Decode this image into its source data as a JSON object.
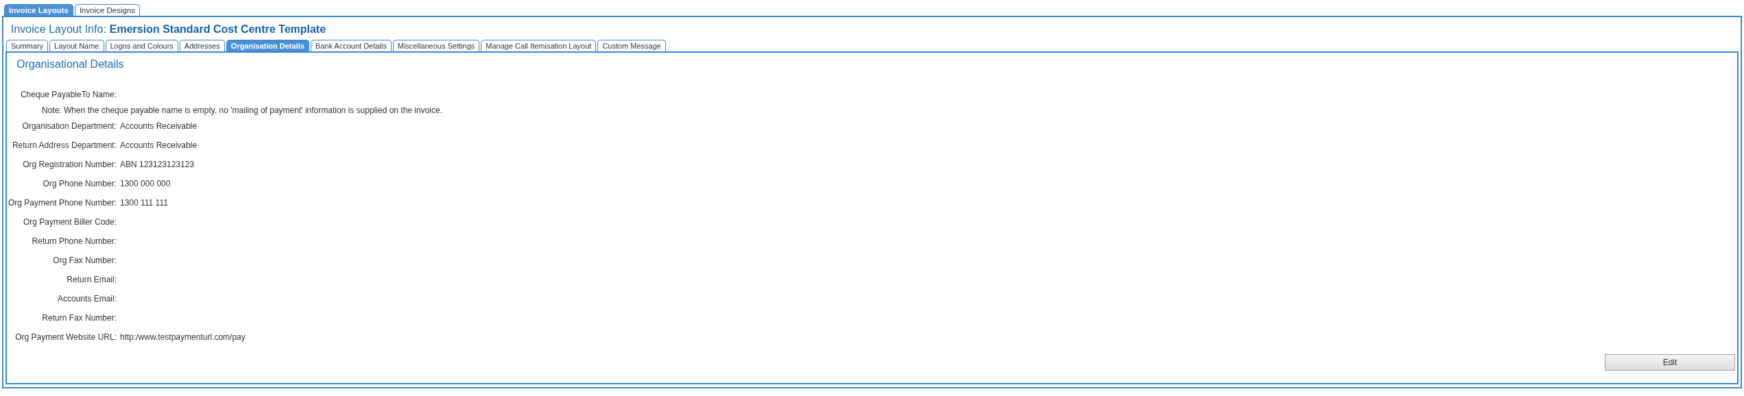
{
  "outer_tabs": [
    {
      "label": "Invoice Layouts",
      "selected": true
    },
    {
      "label": "Invoice Designs",
      "selected": false
    }
  ],
  "header": {
    "label": "Invoice Layout Info:",
    "name": "Emersion Standard Cost Centre Template"
  },
  "inner_tabs": [
    {
      "label": "Summary",
      "selected": false
    },
    {
      "label": "Layout Name",
      "selected": false
    },
    {
      "label": "Logos and Colours",
      "selected": false
    },
    {
      "label": "Addresses",
      "selected": false
    },
    {
      "label": "Organisation Details",
      "selected": true
    },
    {
      "label": "Bank Account Details",
      "selected": false
    },
    {
      "label": "Miscellaneous Settings",
      "selected": false
    },
    {
      "label": "Manage Call Itemisation Layout",
      "selected": false
    },
    {
      "label": "Custom Message",
      "selected": false
    }
  ],
  "section_title": "Organisational Details",
  "fields": [
    {
      "kind": "field",
      "label": "Cheque PayableTo Name:"
    },
    {
      "kind": "note",
      "text": "Note: When the cheque payable name is empty, no 'mailing of payment' information is supplied on the invoice."
    },
    {
      "kind": "field",
      "label": "Organisation Department:",
      "value": "Accounts Receivable"
    },
    {
      "kind": "field",
      "label": "Return Address Department:",
      "value": "Accounts Receivable"
    },
    {
      "kind": "field",
      "label": "Org Registration Number:",
      "value": "ABN 123123123123"
    },
    {
      "kind": "field",
      "label": "Org Phone Number:",
      "value": "1300 000 000"
    },
    {
      "kind": "field",
      "label": "Org Payment Phone Number:",
      "value": "1300 111 111"
    },
    {
      "kind": "field",
      "label": "Org Payment Biller Code:"
    },
    {
      "kind": "field",
      "label": "Return Phone Number:"
    },
    {
      "kind": "field",
      "label": "Org Fax Number:"
    },
    {
      "kind": "field",
      "label": "Return Email:"
    },
    {
      "kind": "field",
      "label": "Accounts Email:"
    },
    {
      "kind": "field",
      "label": "Return Fax Number:"
    },
    {
      "kind": "field",
      "label": "Org Payment Website URL:",
      "value": "http:/www.testpaymenturl.com/pay"
    }
  ],
  "edit_button": "Edit"
}
